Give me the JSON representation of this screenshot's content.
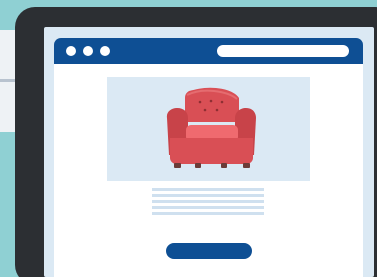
{
  "scene": {
    "background_color": "#8fd0d3",
    "tablet_color": "#2c2f33",
    "screen_color": "#dbe9f4",
    "accent_color": "#0e4f94",
    "product_color": "#d94f55",
    "product_cushion_color": "#ef6a6f",
    "product_leg_color": "#6b3c38"
  },
  "browser": {
    "window_controls": [
      "dot-icon",
      "dot-icon",
      "dot-icon"
    ],
    "address_bar": ""
  },
  "hero": {
    "icon": "armchair-icon"
  },
  "content": {
    "text_lines": 5,
    "button_label": ""
  }
}
